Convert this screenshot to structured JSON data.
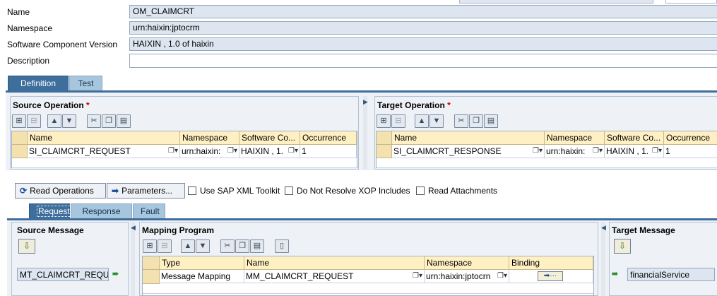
{
  "header": {
    "fields": [
      {
        "label": "Name",
        "value": "OM_CLAIMCRT"
      },
      {
        "label": "Namespace",
        "value": "urn:haixin:jptocrm"
      },
      {
        "label": "Software Component Version",
        "value": "HAIXIN , 1.0 of haixin"
      },
      {
        "label": "Description",
        "value": ""
      }
    ]
  },
  "main_tabs": [
    "Definition",
    "Test"
  ],
  "source_operation": {
    "title": "Source Operation",
    "required": "*",
    "columns": [
      "Name",
      "Namespace",
      "Software Co...",
      "Occurrence"
    ],
    "row": {
      "name": "SI_CLAIMCRT_REQUEST",
      "namespace": "urn:haixin:",
      "swc": "HAIXIN , 1.",
      "occurrence": "1"
    }
  },
  "target_operation": {
    "title": "Target Operation",
    "required": "*",
    "columns": [
      "Name",
      "Namespace",
      "Software Co...",
      "Occurrence"
    ],
    "row": {
      "name": "SI_CLAIMCRT_RESPONSE",
      "namespace": "urn:haixin:",
      "swc": "HAIXIN , 1.",
      "occurrence": "1"
    }
  },
  "actions": {
    "read_operations": "Read Operations",
    "parameters": "Parameters...",
    "checkboxes": [
      "Use SAP XML Toolkit",
      "Do Not Resolve XOP Includes",
      "Read Attachments"
    ]
  },
  "sub_tabs": [
    "Request",
    "Response",
    "Fault"
  ],
  "source_message": {
    "title": "Source Message",
    "value": "MT_CLAIMCRT_REQU"
  },
  "mapping_program": {
    "title": "Mapping Program",
    "columns": [
      "Type",
      "Name",
      "Namespace",
      "Binding"
    ],
    "row": {
      "type": "Message Mapping",
      "name": "MM_CLAIMCRT_REQUEST",
      "namespace": "urn:haixin:jptocrn"
    }
  },
  "target_message": {
    "title": "Target Message",
    "value": "financialService"
  }
}
